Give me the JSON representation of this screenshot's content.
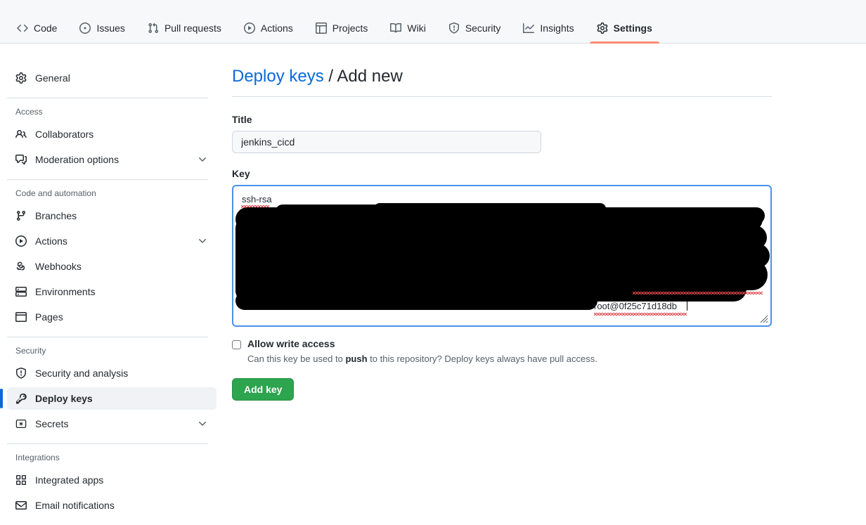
{
  "repo_nav": {
    "items": [
      {
        "label": "Code",
        "icon": "code-icon",
        "active": false
      },
      {
        "label": "Issues",
        "icon": "issue-opened-icon",
        "active": false
      },
      {
        "label": "Pull requests",
        "icon": "git-pull-request-icon",
        "active": false
      },
      {
        "label": "Actions",
        "icon": "play-icon",
        "active": false
      },
      {
        "label": "Projects",
        "icon": "table-icon",
        "active": false
      },
      {
        "label": "Wiki",
        "icon": "book-icon",
        "active": false
      },
      {
        "label": "Security",
        "icon": "shield-icon",
        "active": false
      },
      {
        "label": "Insights",
        "icon": "graph-icon",
        "active": false
      },
      {
        "label": "Settings",
        "icon": "gear-icon",
        "active": true
      }
    ]
  },
  "sidebar": {
    "top_items": [
      {
        "label": "General",
        "icon": "gear-icon"
      }
    ],
    "sections": [
      {
        "heading": "Access",
        "items": [
          {
            "label": "Collaborators",
            "icon": "people-icon",
            "chevron": false
          },
          {
            "label": "Moderation options",
            "icon": "comment-discussion-icon",
            "chevron": true
          }
        ]
      },
      {
        "heading": "Code and automation",
        "items": [
          {
            "label": "Branches",
            "icon": "git-branch-icon",
            "chevron": false
          },
          {
            "label": "Actions",
            "icon": "play-icon",
            "chevron": true
          },
          {
            "label": "Webhooks",
            "icon": "webhook-icon",
            "chevron": false
          },
          {
            "label": "Environments",
            "icon": "server-icon",
            "chevron": false
          },
          {
            "label": "Pages",
            "icon": "browser-icon",
            "chevron": false
          }
        ]
      },
      {
        "heading": "Security",
        "items": [
          {
            "label": "Security and analysis",
            "icon": "shield-icon",
            "chevron": false,
            "selected": false
          },
          {
            "label": "Deploy keys",
            "icon": "key-icon",
            "chevron": false,
            "selected": true
          },
          {
            "label": "Secrets",
            "icon": "asterisk-key-icon",
            "chevron": true,
            "selected": false
          }
        ]
      },
      {
        "heading": "Integrations",
        "items": [
          {
            "label": "Integrated apps",
            "icon": "apps-grid-icon",
            "chevron": false
          },
          {
            "label": "Email notifications",
            "icon": "mail-icon",
            "chevron": false
          }
        ]
      }
    ]
  },
  "main": {
    "breadcrumb_link": "Deploy keys",
    "breadcrumb_separator": " / ",
    "breadcrumb_current": "Add new",
    "title_field": {
      "label": "Title",
      "value": "jenkins_cicd",
      "placeholder": ""
    },
    "key_field": {
      "label": "Key",
      "line1": "ssh-rsa",
      "trailing": "root@0f25c71d18db",
      "redacted": true
    },
    "allow_write": {
      "label": "Allow write access",
      "checked": false,
      "help_prefix": "Can this key be used to ",
      "help_bold": "push",
      "help_suffix": " to this repository? Deploy keys always have pull access."
    },
    "submit_label": "Add key"
  },
  "colors": {
    "accent_blue": "#0969da",
    "active_tab_underline": "#fd8c73",
    "button_green": "#2da44e",
    "nav_bg": "#f6f8fa",
    "border": "#d8dee4",
    "spellcheck_red": "#e5484d"
  }
}
